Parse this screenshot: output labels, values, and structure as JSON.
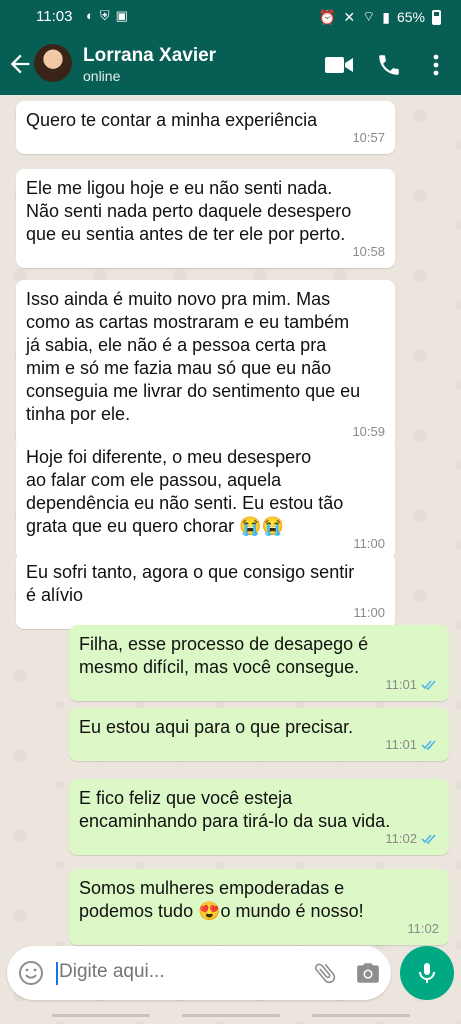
{
  "status_bar": {
    "time": "11:03",
    "battery": "65%"
  },
  "header": {
    "contact_name": "Lorrana Xavier",
    "presence": "online"
  },
  "messages": [
    {
      "dir": "in",
      "text": "Quero te contar a minha experiência",
      "time": "10:57"
    },
    {
      "dir": "in",
      "text": "Ele me ligou hoje e eu não senti nada.\nNão senti nada perto daquele desespero\nque eu sentia antes de ter ele por perto.",
      "time": "10:58"
    },
    {
      "dir": "in",
      "text": "Isso ainda é muito novo pra mim. Mas\ncomo as cartas mostraram e eu também\njá sabia, ele não é a pessoa certa pra\nmim e só me fazia mau só que eu não\nconseguia me livrar do sentimento que eu\ntinha por ele.",
      "time": "10:59"
    },
    {
      "dir": "in",
      "text": "Hoje foi diferente, o meu desespero\nao falar com ele passou, aquela\ndependência eu não senti. Eu estou tão\ngrata que eu quero chorar 😭😭",
      "time": "11:00"
    },
    {
      "dir": "in",
      "text": "Eu sofri tanto, agora o que consigo sentir\né alívio",
      "time": "11:00"
    },
    {
      "dir": "out",
      "text": "Filha, esse processo de desapego é\nmesmo difícil, mas você consegue.",
      "time": "11:01"
    },
    {
      "dir": "out",
      "text": "Eu estou aqui para o que precisar.",
      "time": "11:01"
    },
    {
      "dir": "out",
      "text": "E fico feliz que você esteja\nencaminhando para tirá-lo da sua vida.",
      "time": "11:02"
    },
    {
      "dir": "out",
      "text": "Somos mulheres empoderadas e\npodemos tudo 😍o mundo é nosso!",
      "time": "11:02"
    }
  ],
  "composer": {
    "placeholder": "Digite aqui..."
  },
  "colors": {
    "header": "#075e54",
    "outgoing_bubble": "#dcf8c6",
    "incoming_bubble": "#ffffff",
    "read_ticks": "#4fb6ec",
    "mic_button": "#00a884"
  }
}
